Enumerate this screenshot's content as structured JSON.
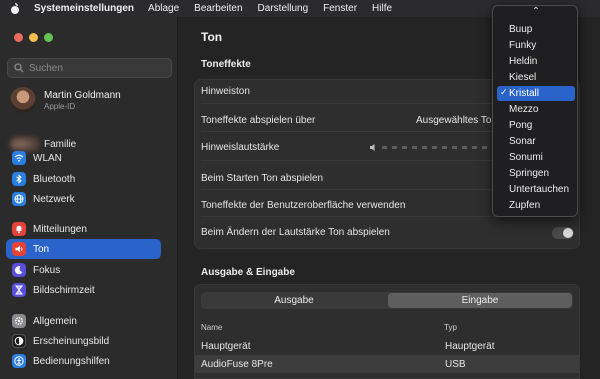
{
  "menubar": {
    "app": "Systemeinstellungen",
    "items": [
      "Ablage",
      "Bearbeiten",
      "Darstellung",
      "Fenster",
      "Hilfe"
    ]
  },
  "sidebar": {
    "search_placeholder": "Suchen",
    "user": {
      "name": "Martin Goldmann",
      "sub": "Apple-ID"
    },
    "family": "Familie",
    "items": [
      {
        "label": "WLAN",
        "icon": "wifi-icon",
        "color": "#2a7de1"
      },
      {
        "label": "Bluetooth",
        "icon": "bluetooth-icon",
        "color": "#2a7de1"
      },
      {
        "label": "Netzwerk",
        "icon": "globe-icon",
        "color": "#2a7de1"
      },
      {
        "label": "Mitteilungen",
        "icon": "bell-icon",
        "color": "#e5433a"
      },
      {
        "label": "Ton",
        "icon": "speaker-icon",
        "color": "#e5433a"
      },
      {
        "label": "Fokus",
        "icon": "moon-icon",
        "color": "#5a4fd8"
      },
      {
        "label": "Bildschirmzeit",
        "icon": "hourglass-icon",
        "color": "#5a4fd8"
      },
      {
        "label": "Allgemein",
        "icon": "gear-icon",
        "color": "#8a8a8e"
      },
      {
        "label": "Erscheinungsbild",
        "icon": "appearance-icon",
        "color": "#1c1c1e"
      },
      {
        "label": "Bedienungshilfen",
        "icon": "accessibility-icon",
        "color": "#2a7de1"
      }
    ]
  },
  "main": {
    "title": "Ton",
    "section1": "Toneffekte",
    "rows": {
      "hinweiston": "Hinweiston",
      "abspielen_ueber": "Toneffekte abspielen über",
      "abspielen_value": "Ausgewähltes To",
      "lautstaerke": "Hinweislautstärke",
      "starten": "Beim Starten Ton abspielen",
      "oberflaeche": "Toneffekte der Benutzeroberfläche verwenden",
      "aendern": "Beim Ändern der Lautstärke Ton abspielen"
    },
    "section2": "Ausgabe & Eingabe",
    "segments": [
      "Ausgabe",
      "Eingabe"
    ],
    "table": {
      "headers": [
        "Name",
        "Typ"
      ],
      "rows": [
        [
          "Hauptgerät",
          "Hauptgerät"
        ],
        [
          "AudioFuse 8Pre",
          "USB"
        ]
      ]
    }
  },
  "popup": {
    "options": [
      "Buup",
      "Funky",
      "Heldin",
      "Kiesel",
      "Kristall",
      "Mezzo",
      "Pong",
      "Sonar",
      "Sonumi",
      "Springen",
      "Untertauchen",
      "Zupfen"
    ],
    "selected": "Kristall"
  }
}
